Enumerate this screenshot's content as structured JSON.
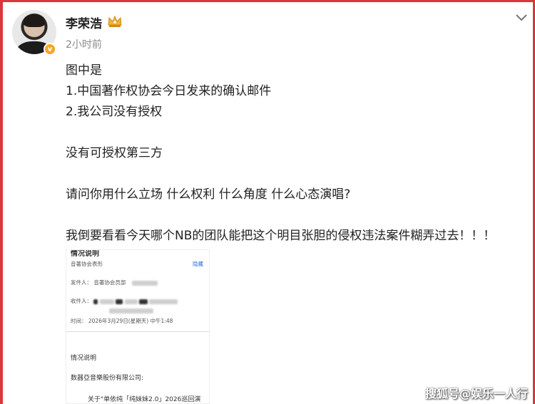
{
  "user": {
    "name": "李荣浩",
    "verified_badge": "v",
    "badge_icon": "crown-icon"
  },
  "post": {
    "time": "2小时前",
    "lines": [
      "图中是",
      "1.中国著作权协会今日发来的确认邮件",
      "2.我公司没有授权",
      "没有可授权第三方",
      "请问你用什么立场 什么权利 什么角度 什么心态演唱?",
      "我倒要看看今天哪个NB的团队能把这个明目张胆的侵权违法案件糊弄过去！！！"
    ]
  },
  "email": {
    "header_cut": "情况说明",
    "from_org": "音著协会表形",
    "hide_label": "隐藏",
    "sender_label": "发件人：",
    "sender_value": "音著协会员部",
    "receiver_label": "收件人：",
    "time_label": "时间：",
    "time_value": "2026年3月29日(星期天) 中午1:48",
    "body_title": "情况说明",
    "company": "数器亞音樂股份有限公司:",
    "body_line": "关于\"单依纯「纯妹妹2.0」2026巡回演"
  },
  "watermark": "搜狐号@娱乐一人行",
  "colors": {
    "frame": "#d9383a",
    "badge": "#f5a623",
    "link": "#2a6fd6"
  }
}
